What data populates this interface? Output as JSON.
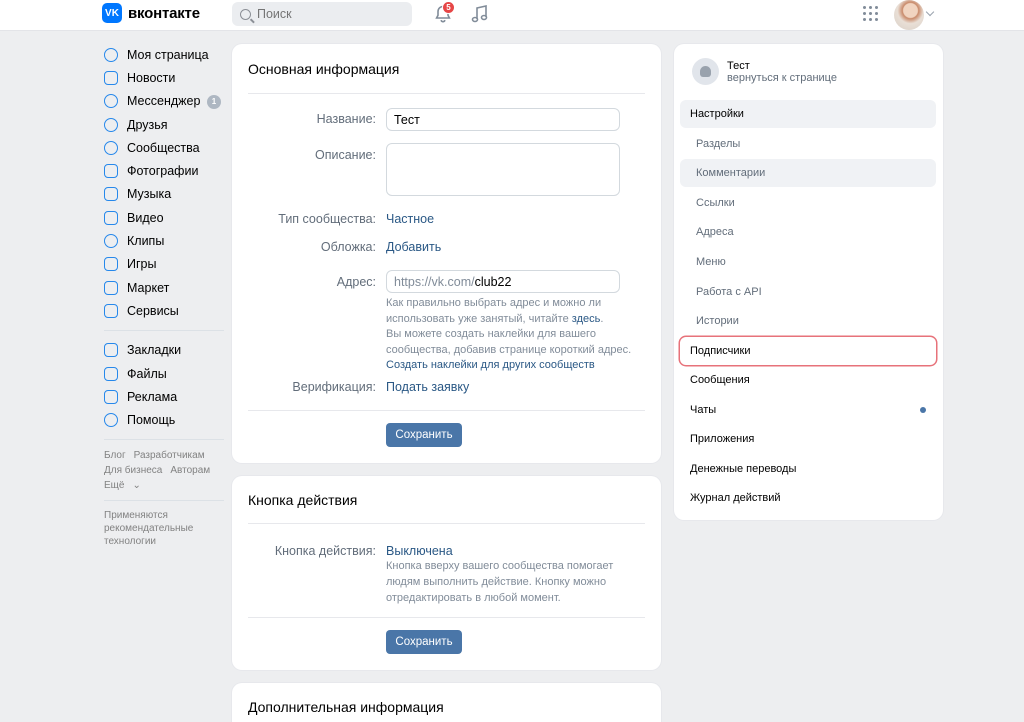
{
  "header": {
    "logo_mark": "VK",
    "logo_text": "вконтакте",
    "search_placeholder": "Поиск",
    "notifications_count": "5"
  },
  "leftnav": {
    "items": [
      {
        "label": "Моя страница",
        "icon": "user-circle-icon"
      },
      {
        "label": "Новости",
        "icon": "news-icon"
      },
      {
        "label": "Мессенджер",
        "icon": "message-icon",
        "counter": "1"
      },
      {
        "label": "Друзья",
        "icon": "friends-icon"
      },
      {
        "label": "Сообщества",
        "icon": "communities-icon"
      },
      {
        "label": "Фотографии",
        "icon": "photo-icon"
      },
      {
        "label": "Музыка",
        "icon": "music-icon"
      },
      {
        "label": "Видео",
        "icon": "video-icon"
      },
      {
        "label": "Клипы",
        "icon": "clips-icon"
      },
      {
        "label": "Игры",
        "icon": "games-icon"
      },
      {
        "label": "Маркет",
        "icon": "market-icon"
      },
      {
        "label": "Сервисы",
        "icon": "services-icon"
      }
    ],
    "items2": [
      {
        "label": "Закладки",
        "icon": "bookmark-icon"
      },
      {
        "label": "Файлы",
        "icon": "file-icon"
      },
      {
        "label": "Реклама",
        "icon": "ads-icon"
      },
      {
        "label": "Помощь",
        "icon": "help-icon"
      }
    ],
    "footer_links": [
      "Блог",
      "Разработчикам",
      "Для бизнеса",
      "Авторам",
      "Ещё"
    ],
    "footer_note": "Применяются рекомендательные технологии"
  },
  "main_info": {
    "title": "Основная информация",
    "name_label": "Название:",
    "name_value": "Тест",
    "desc_label": "Описание:",
    "type_label": "Тип сообщества:",
    "type_value": "Частное",
    "cover_label": "Обложка:",
    "cover_value": "Добавить",
    "address_label": "Адрес:",
    "address_prefix": "https://vk.com/",
    "address_value": "club22",
    "hint1": "Как правильно выбрать адрес и можно ли использовать уже занятый, читайте",
    "hint1_link": "здесь",
    "hint2": "Вы можете создать наклейки для вашего сообщества, добавив странице короткий адрес.",
    "hint2_link": "Создать наклейки для других сообществ",
    "verify_label": "Верификация:",
    "verify_value": "Подать заявку",
    "save": "Сохранить"
  },
  "action_button": {
    "title": "Кнопка действия",
    "label": "Кнопка действия:",
    "value": "Выключена",
    "hint": "Кнопка вверху вашего сообщества помогает людям выполнить действие. Кнопку можно отредактировать в любой момент.",
    "save": "Сохранить"
  },
  "extra_info": {
    "title": "Дополнительная информация"
  },
  "right_menu": {
    "group_name": "Тест",
    "back_link": "вернуться к странице",
    "items": [
      {
        "label": "Настройки"
      },
      {
        "label": "Разделы"
      },
      {
        "label": "Комментарии"
      },
      {
        "label": "Ссылки"
      },
      {
        "label": "Адреса"
      },
      {
        "label": "Меню"
      },
      {
        "label": "Работа с API"
      },
      {
        "label": "Истории"
      },
      {
        "label": "Подписчики"
      },
      {
        "label": "Сообщения"
      },
      {
        "label": "Чаты"
      },
      {
        "label": "Приложения"
      },
      {
        "label": "Денежные переводы"
      },
      {
        "label": "Журнал действий"
      }
    ]
  },
  "colors": {
    "accent": "#2688eb",
    "button": "#4a76a8",
    "link": "#2a5885",
    "highlight_circle": "#e7727a"
  }
}
